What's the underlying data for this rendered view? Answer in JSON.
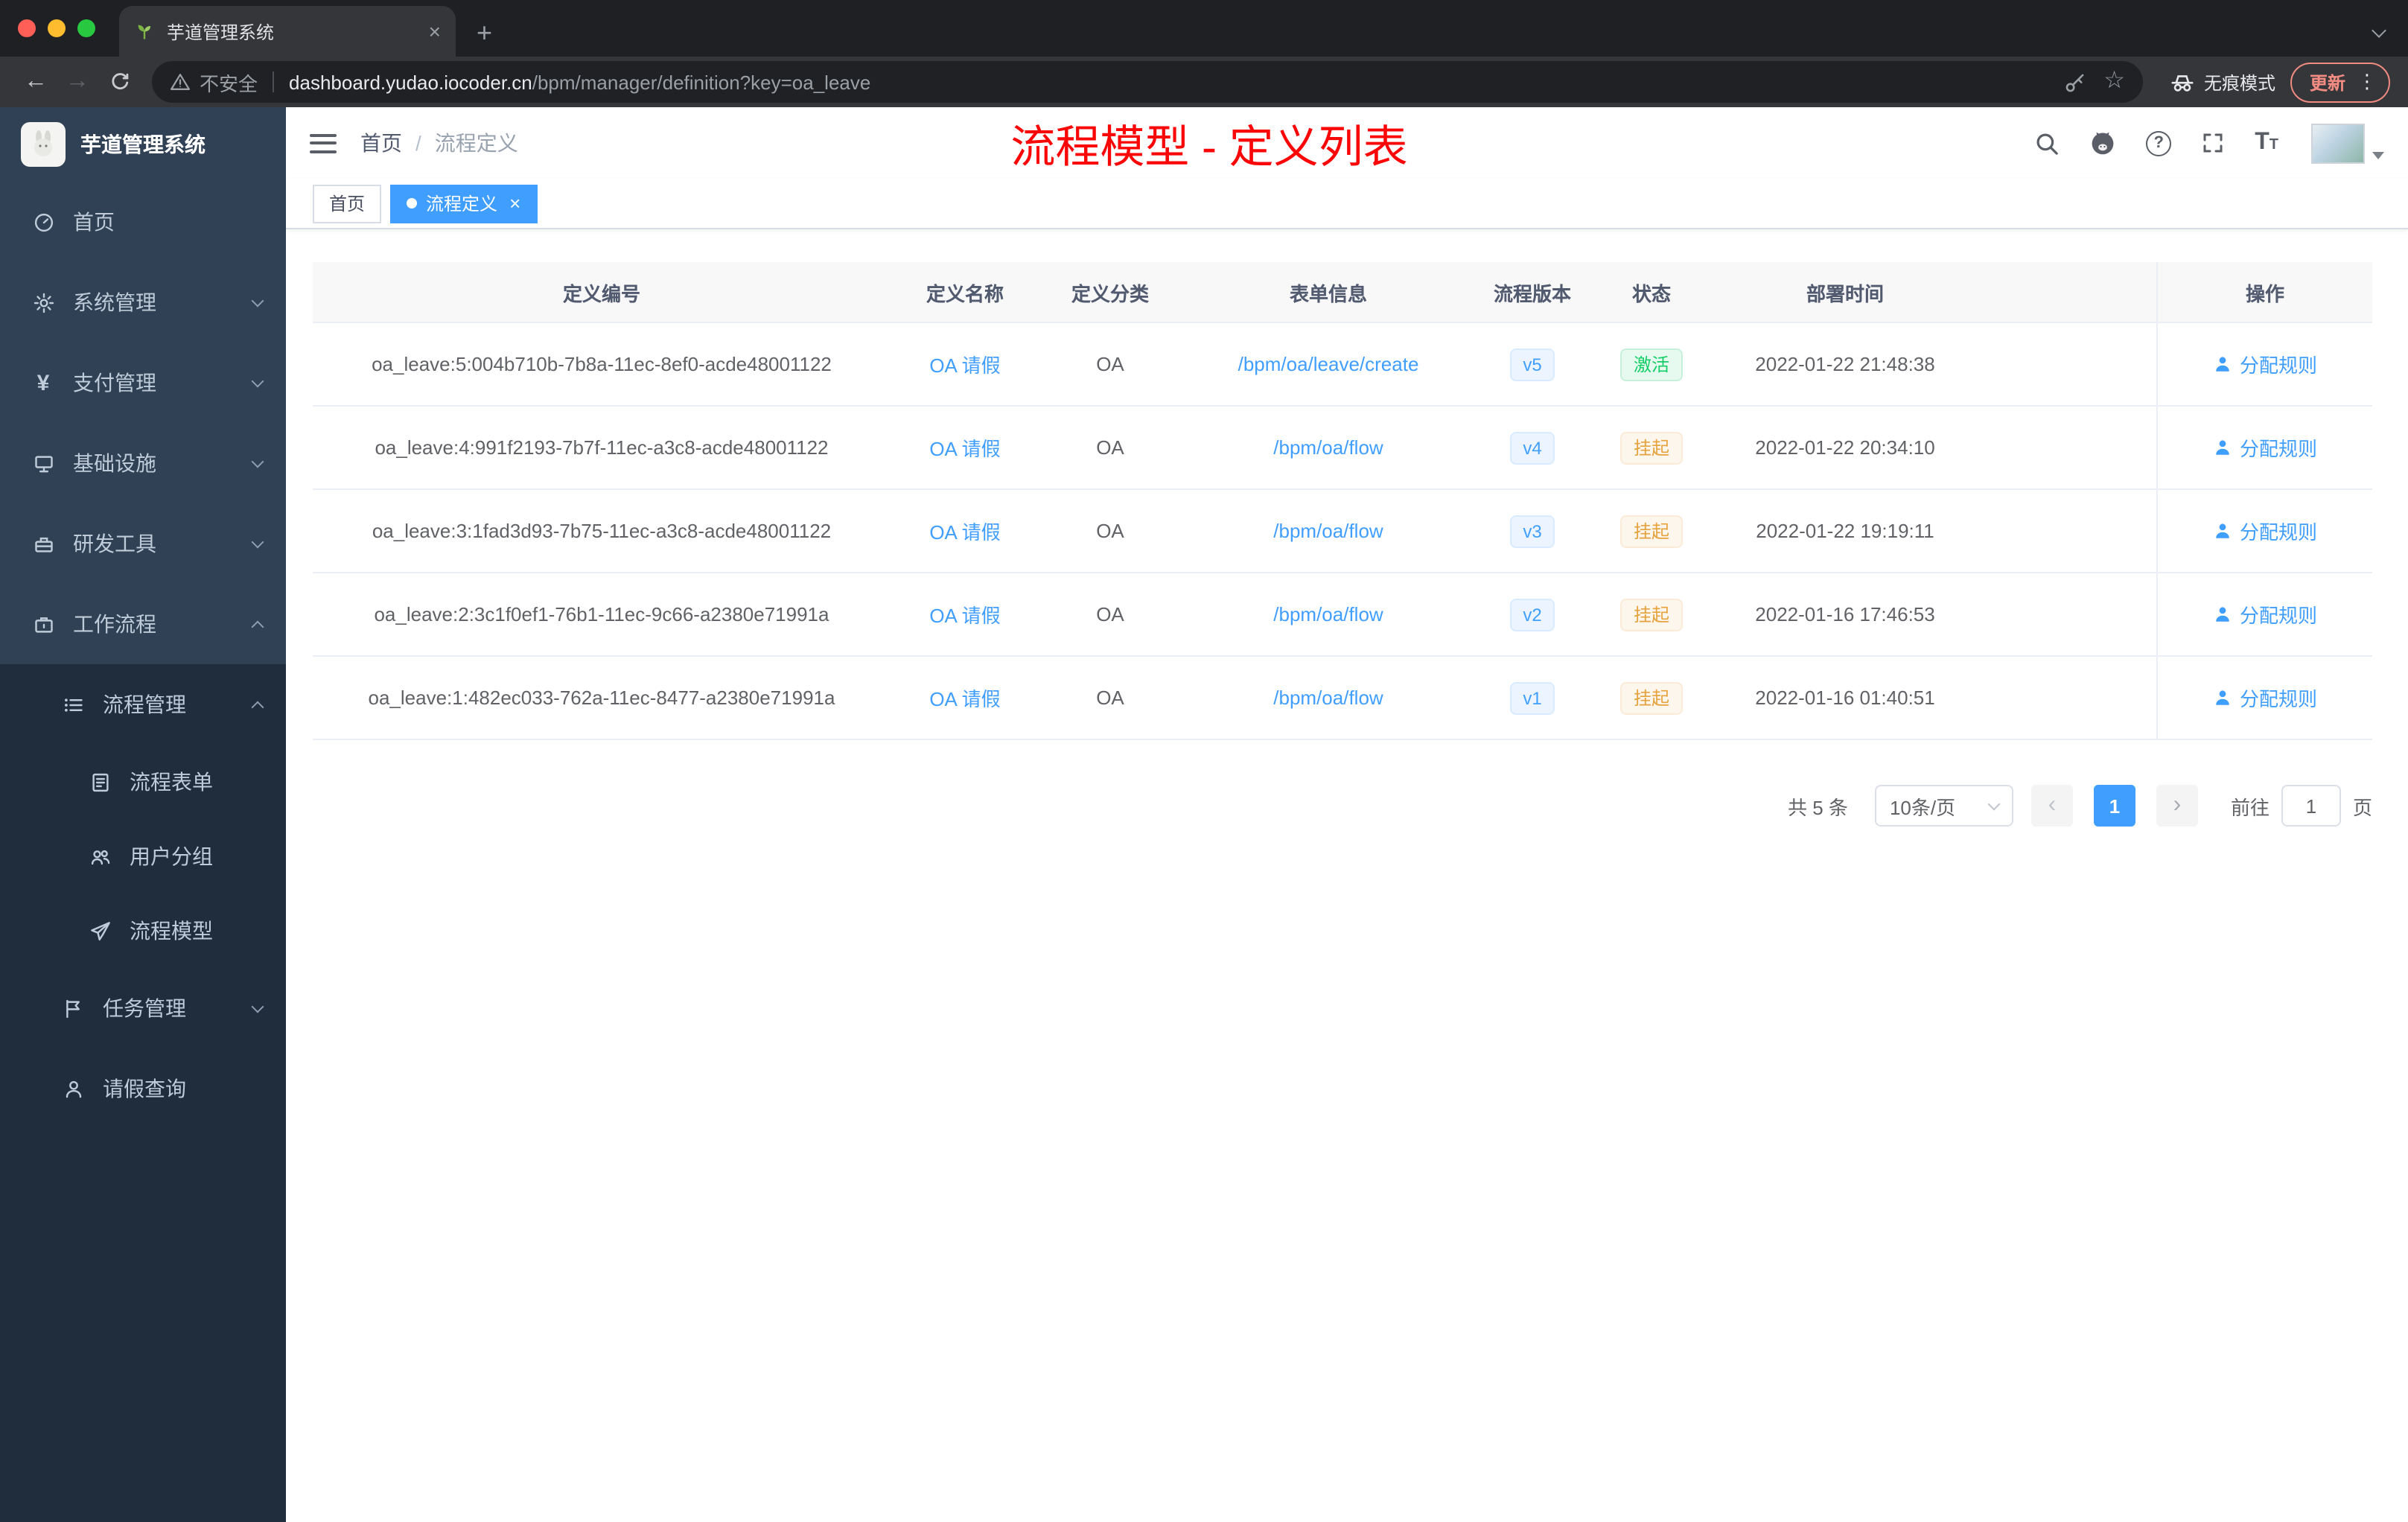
{
  "colors": {
    "accent": "#409eff",
    "success": "#13ce66",
    "warning": "#e6a23c",
    "annotation_red": "#fb0606",
    "sidebar_bg": "#304156",
    "sidebar_sub_bg": "#1f2d3d"
  },
  "glyphs": {
    "close": "×",
    "plus": "+",
    "dots": "⋮",
    "prev": "‹",
    "next": "›",
    "slash": "/",
    "back": "←",
    "forward": "→",
    "star": "☆",
    "yen": "¥",
    "question": "?"
  },
  "browser": {
    "tab_title": "芋道管理系统",
    "security_label": "不安全",
    "url_host": "dashboard.yudao.iocoder.cn",
    "url_path": "/bpm/manager/definition?key=oa_leave",
    "incognito_label": "无痕模式",
    "update_label": "更新"
  },
  "sidebar": {
    "app_title": "芋道管理系统",
    "items": [
      {
        "label": "首页"
      },
      {
        "label": "系统管理"
      },
      {
        "label": "支付管理"
      },
      {
        "label": "基础设施"
      },
      {
        "label": "研发工具"
      },
      {
        "label": "工作流程"
      },
      {
        "label": "流程管理"
      },
      {
        "label": "流程表单"
      },
      {
        "label": "用户分组"
      },
      {
        "label": "流程模型"
      },
      {
        "label": "任务管理"
      },
      {
        "label": "请假查询"
      }
    ]
  },
  "header": {
    "breadcrumb_home": "首页",
    "breadcrumb_current": "流程定义",
    "annotation": "流程模型 - 定义列表"
  },
  "tags": {
    "home": "首页",
    "active": "流程定义"
  },
  "table": {
    "columns": {
      "id": "定义编号",
      "name": "定义名称",
      "category": "定义分类",
      "form": "表单信息",
      "version": "流程版本",
      "status": "状态",
      "deploy_time": "部署时间",
      "actions": "操作"
    },
    "rows": [
      {
        "id": "oa_leave:5:004b710b-7b8a-11ec-8ef0-acde48001122",
        "name": "OA 请假",
        "category": "OA",
        "form": "/bpm/oa/leave/create",
        "version": "v5",
        "status": "激活",
        "deploy_time": "2022-01-22 21:48:38",
        "action": "分配规则"
      },
      {
        "id": "oa_leave:4:991f2193-7b7f-11ec-a3c8-acde48001122",
        "name": "OA 请假",
        "category": "OA",
        "form": "/bpm/oa/flow",
        "version": "v4",
        "status": "挂起",
        "deploy_time": "2022-01-22 20:34:10",
        "action": "分配规则"
      },
      {
        "id": "oa_leave:3:1fad3d93-7b75-11ec-a3c8-acde48001122",
        "name": "OA 请假",
        "category": "OA",
        "form": "/bpm/oa/flow",
        "version": "v3",
        "status": "挂起",
        "deploy_time": "2022-01-22 19:19:11",
        "action": "分配规则"
      },
      {
        "id": "oa_leave:2:3c1f0ef1-76b1-11ec-9c66-a2380e71991a",
        "name": "OA 请假",
        "category": "OA",
        "form": "/bpm/oa/flow",
        "version": "v2",
        "status": "挂起",
        "deploy_time": "2022-01-16 17:46:53",
        "action": "分配规则"
      },
      {
        "id": "oa_leave:1:482ec033-762a-11ec-8477-a2380e71991a",
        "name": "OA 请假",
        "category": "OA",
        "form": "/bpm/oa/flow",
        "version": "v1",
        "status": "挂起",
        "deploy_time": "2022-01-16 01:40:51",
        "action": "分配规则"
      }
    ]
  },
  "pagination": {
    "total": "共 5 条",
    "page_size": "10条/页",
    "page": "1",
    "goto_label": "前往",
    "goto_value": "1",
    "page_unit": "页"
  }
}
